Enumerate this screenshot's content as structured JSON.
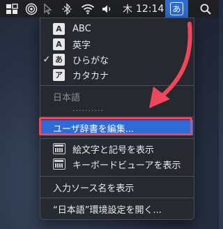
{
  "menubar": {
    "clock_day": "木",
    "clock_time": "12:14",
    "ime_badge": "あ",
    "icons": [
      "window-icon",
      "target-icon",
      "cursor-icon",
      "bluetooth-icon",
      "wifi-icon",
      "volume-icon",
      "search-icon"
    ]
  },
  "dropdown": {
    "modes": [
      {
        "badge": "A",
        "label": "ABC",
        "checked": false
      },
      {
        "badge": "A",
        "label": "英字",
        "checked": false
      },
      {
        "badge": "あ",
        "label": "ひらがな",
        "checked": true
      },
      {
        "badge": "ア",
        "label": "カタカナ",
        "checked": false
      }
    ],
    "check_mark": "✓",
    "section_label": "日本語",
    "section_dots": "..........",
    "user_dictionary": "ユーザ辞書を編集...",
    "emoji_viewer": "絵文字と記号を表示",
    "keyboard_viewer": "キーボードビューアを表示",
    "show_input_source_name": "入力ソース名を表示",
    "open_preferences": "“日本語”環境設定を開く..."
  },
  "colors": {
    "highlight": "#2d6bd6",
    "annotation_red": "#f2465a",
    "menubar": "#1e2024"
  }
}
